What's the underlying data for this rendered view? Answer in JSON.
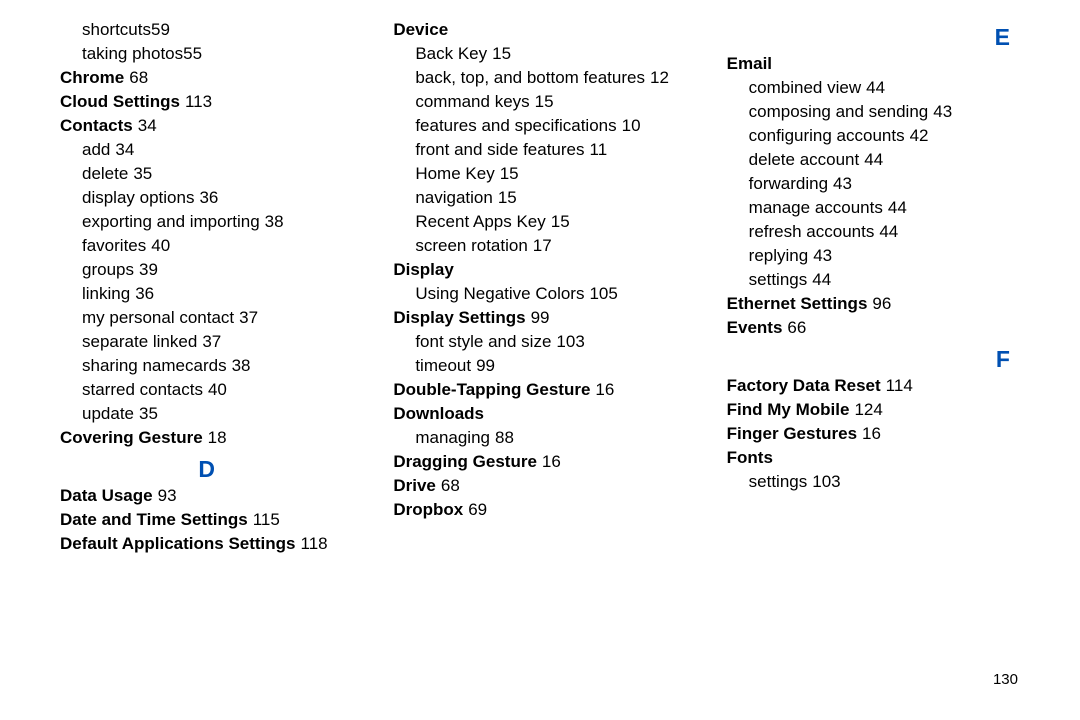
{
  "page_number": "130",
  "col1": {
    "pre_items": [
      {
        "label": "shortcuts",
        "page": "59"
      },
      {
        "label": "taking photos",
        "page": "55"
      }
    ],
    "chrome": {
      "label": "Chrome",
      "page": "68"
    },
    "cloud_settings": {
      "label": "Cloud Settings",
      "page": "113"
    },
    "contacts": {
      "label": "Contacts",
      "page": "34",
      "subs": [
        {
          "label": "add",
          "page": "34"
        },
        {
          "label": "delete",
          "page": "35"
        },
        {
          "label": "display options",
          "page": "36"
        },
        {
          "label": "exporting and importing",
          "page": "38"
        },
        {
          "label": "favorites",
          "page": "40"
        },
        {
          "label": "groups",
          "page": "39"
        },
        {
          "label": "linking",
          "page": "36"
        },
        {
          "label": "my personal contact",
          "page": "37"
        },
        {
          "label": "separate linked",
          "page": "37"
        },
        {
          "label": "sharing namecards",
          "page": "38"
        },
        {
          "label": "starred contacts",
          "page": "40"
        },
        {
          "label": "update",
          "page": "35"
        }
      ]
    },
    "covering_gesture": {
      "label": "Covering Gesture",
      "page": "18"
    },
    "letter_d": "D",
    "data_usage": {
      "label": "Data Usage",
      "page": "93"
    },
    "date_time": {
      "label": "Date and Time Settings",
      "page": "115"
    },
    "default_apps": {
      "label": "Default Applications Settings",
      "page": "118"
    }
  },
  "col2": {
    "device": {
      "label": "Device",
      "subs": [
        {
          "label": "Back Key",
          "page": "15"
        },
        {
          "label": "back, top, and bottom features",
          "page": "12"
        },
        {
          "label": "command keys",
          "page": "15"
        },
        {
          "label": "features and specifications",
          "page": "10"
        },
        {
          "label": "front and side features",
          "page": "11"
        },
        {
          "label": "Home Key",
          "page": "15"
        },
        {
          "label": "navigation",
          "page": "15"
        },
        {
          "label": "Recent Apps Key",
          "page": "15"
        },
        {
          "label": "screen rotation",
          "page": "17"
        }
      ]
    },
    "display": {
      "label": "Display",
      "subs": [
        {
          "label": "Using Negative Colors",
          "page": "105"
        }
      ]
    },
    "display_settings": {
      "label": "Display Settings",
      "page": "99",
      "subs": [
        {
          "label": "font style and size",
          "page": "103"
        },
        {
          "label": "timeout",
          "page": "99"
        }
      ]
    },
    "double_tap": {
      "label": "Double-Tapping Gesture",
      "page": "16"
    },
    "downloads": {
      "label": "Downloads",
      "subs": [
        {
          "label": "managing",
          "page": "88"
        }
      ]
    },
    "dragging": {
      "label": "Dragging Gesture",
      "page": "16"
    },
    "drive": {
      "label": "Drive",
      "page": "68"
    },
    "dropbox": {
      "label": "Dropbox",
      "page": "69"
    }
  },
  "col3": {
    "letter_e": "E",
    "email": {
      "label": "Email",
      "subs": [
        {
          "label": "combined view",
          "page": "44"
        },
        {
          "label": "composing and sending",
          "page": "43"
        },
        {
          "label": "configuring accounts",
          "page": "42"
        },
        {
          "label": "delete account",
          "page": "44"
        },
        {
          "label": "forwarding",
          "page": "43"
        },
        {
          "label": "manage accounts",
          "page": "44"
        },
        {
          "label": "refresh accounts",
          "page": "44"
        },
        {
          "label": "replying",
          "page": "43"
        },
        {
          "label": "settings",
          "page": "44"
        }
      ]
    },
    "ethernet": {
      "label": "Ethernet Settings",
      "page": "96"
    },
    "events": {
      "label": "Events",
      "page": "66"
    },
    "letter_f": "F",
    "factory_reset": {
      "label": "Factory Data Reset",
      "page": "114"
    },
    "find_my_mobile": {
      "label": "Find My Mobile",
      "page": "124"
    },
    "finger_gestures": {
      "label": "Finger Gestures",
      "page": "16"
    },
    "fonts": {
      "label": "Fonts",
      "subs": [
        {
          "label": "settings",
          "page": "103"
        }
      ]
    }
  }
}
